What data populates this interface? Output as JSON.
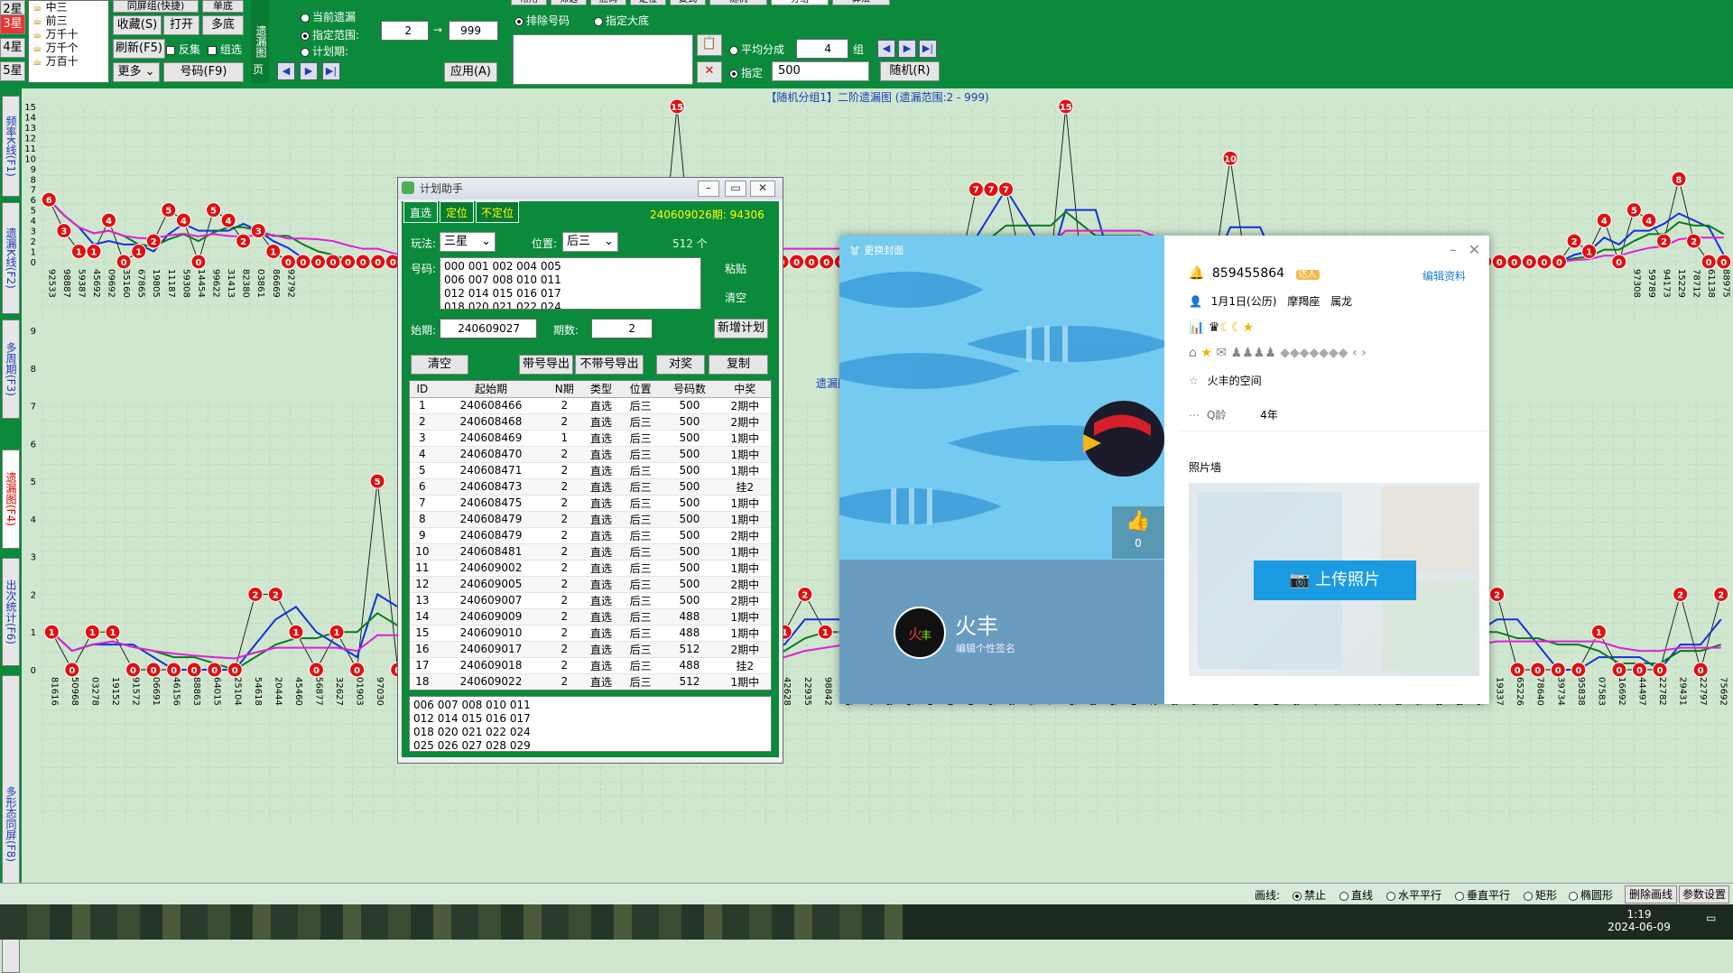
{
  "toolbar": {
    "star_tabs": [
      "2星",
      "3星",
      "4星",
      "5星"
    ],
    "pos_list": [
      "中三",
      "前三",
      "万千十",
      "万千个",
      "万百十"
    ],
    "combo_mode": "同屏组(快捷)",
    "btn_dandi": "单底",
    "btn_fav": "收藏(S)",
    "btn_open": "打开",
    "btn_duodi": "多底",
    "btn_refresh": "刷新(F5)",
    "chk_reverse": "反集",
    "chk_group": "组选",
    "btn_more": "更多",
    "btn_numbers": "号码(F9)",
    "vlabel": "遗漏图",
    "opt_current": "当前遗漏",
    "opt_range": "指定范围:",
    "opt_plan": "计划期:",
    "range_from": "2",
    "range_to": "999",
    "page_label": "页",
    "btn_apply": "应用(A)",
    "opt_exclude": "排除号码",
    "opt_bigbase": "指定大底",
    "opt_avg": "平均分成",
    "avg_groups": "4",
    "group_unit": "组",
    "opt_spec": "指定",
    "spec_value": "500",
    "btn_random": "随机(R)",
    "top_tabs": [
      "常用",
      "筛选",
      "胆码",
      "定位",
      "复式",
      "随机",
      "分组",
      "算法"
    ]
  },
  "left_tabs": [
    "频率K线(F1)",
    "遗漏K线(F2)",
    "多周期(F3)",
    "遗漏图(F4)",
    "出次统计(F6)",
    "多形态同屏(F8)"
  ],
  "chart_data": [
    {
      "type": "line",
      "title": "【随机分组1】二阶遗漏图 (遗漏范围:2 - 999)",
      "ylim": [
        0,
        15
      ],
      "categories": [
        "92533",
        "98887",
        "59387",
        "45692",
        "09692",
        "35160",
        "67865",
        "19805",
        "11187",
        "59308",
        "14454",
        "99622",
        "31413",
        "82380",
        "03861",
        "86669",
        "92792",
        "",
        "",
        "",
        "",
        "",
        "",
        "",
        "",
        "",
        "",
        "",
        "",
        "",
        "",
        "",
        "",
        "",
        "",
        "",
        "",
        "",
        "",
        "",
        "",
        "",
        "",
        "",
        "",
        "",
        "",
        "",
        "",
        "",
        "",
        "",
        "",
        "",
        "",
        "",
        "",
        "96785",
        "12555",
        "",
        "",
        "",
        "",
        "",
        "",
        "",
        "",
        "",
        "",
        "",
        "",
        "",
        "",
        "",
        "",
        "",
        "",
        "",
        "",
        "",
        "",
        "",
        "",
        "",
        "",
        "",
        "",
        "",
        "",
        "",
        "",
        "",
        "",
        "",
        "",
        "",
        "",
        "",
        "",
        "",
        "",
        "",
        "",
        "",
        "",
        "",
        "97308",
        "59789",
        "94173",
        "15229",
        "78712",
        "61138",
        "88975",
        "33399",
        "22782",
        "75692"
      ],
      "series": [
        {
          "name": "遗漏",
          "values": [
            6,
            3,
            1,
            1,
            4,
            0,
            1,
            2,
            5,
            4,
            0,
            5,
            4,
            2,
            3,
            1,
            0,
            0,
            0,
            0,
            0,
            0,
            0,
            0,
            0,
            0,
            0,
            0,
            0,
            0,
            0,
            0,
            0,
            0,
            0,
            0,
            0,
            0,
            0,
            0,
            0,
            0,
            15,
            0,
            0,
            0,
            0,
            0,
            0,
            0,
            0,
            0,
            0,
            0,
            0,
            0,
            0,
            0,
            0,
            0,
            0,
            0,
            7,
            7,
            7,
            0,
            0,
            0,
            15,
            0,
            0,
            0,
            0,
            0,
            0,
            0,
            0,
            0,
            0,
            10,
            0,
            0,
            0,
            0,
            0,
            0,
            0,
            0,
            0,
            0,
            0,
            0,
            0,
            0,
            0,
            0,
            0,
            0,
            0,
            0,
            0,
            0,
            2,
            1,
            4,
            0,
            5,
            4,
            2,
            8,
            2,
            0,
            0
          ]
        }
      ],
      "chart_type_note": ""
    },
    {
      "type": "line",
      "title": "遗漏图 (历史",
      "ylim": [
        0,
        9
      ],
      "categories": [
        "81616",
        "50968",
        "03278",
        "19152",
        "91572",
        "06691",
        "46156",
        "88863",
        "64015",
        "25104",
        "54618",
        "20444",
        "45460",
        "56877",
        "32627",
        "01903",
        "97030",
        "25837",
        "00379",
        "13975",
        "01914",
        "55657",
        "86436",
        "09297",
        "65618",
        "95653",
        "30028",
        "45679",
        "83330",
        "11862",
        "25095",
        "33418",
        "18155",
        "23868",
        "79418",
        "16677",
        "42628",
        "22935",
        "98842",
        "65376",
        "39337",
        "64623",
        "64096",
        "39709",
        "37190",
        "78800",
        "57035",
        "34703",
        "59774",
        "32421",
        "10236",
        "97308",
        "84186",
        "65789",
        "69352",
        "23143",
        "73285",
        "17403",
        "73351",
        "15229",
        "62340",
        "72433",
        "03954",
        "24164",
        "91452",
        "78712",
        "52193",
        "39854",
        "61138",
        "32788",
        "88975",
        "19337",
        "65226",
        "78640",
        "39734",
        "95838",
        "07583",
        "16692",
        "44497",
        "22782",
        "29431",
        "22797",
        "75692"
      ],
      "series": [
        {
          "name": "遗漏",
          "values": [
            1,
            0,
            1,
            1,
            0,
            0,
            0,
            0,
            0,
            0,
            2,
            2,
            1,
            0,
            1,
            0,
            5,
            0,
            0,
            1,
            0,
            1,
            0,
            0,
            0,
            0,
            0,
            0,
            1,
            0,
            0,
            0,
            0,
            1,
            0,
            1,
            1,
            2,
            1,
            1,
            0,
            0,
            0,
            0,
            2,
            0,
            0,
            0,
            0,
            0,
            0,
            0,
            0,
            2,
            1,
            0,
            0,
            0,
            0,
            1,
            0,
            0,
            0,
            0,
            1,
            2,
            1,
            0,
            1,
            0,
            2,
            2,
            0,
            0,
            0,
            0,
            1,
            0,
            0,
            0,
            2,
            0,
            2
          ]
        }
      ]
    }
  ],
  "planner": {
    "title": "计划助手",
    "tabs": [
      "直选",
      "定位",
      "不定位"
    ],
    "period_info": "240609026期:",
    "period_num": "94306",
    "play_label": "玩法:",
    "play_value": "三星",
    "pos_label": "位置:",
    "pos_value": "后三",
    "count": "512 个",
    "code_label": "号码:",
    "codes": [
      "000 001 002 004 005",
      "006 007 008 010 011",
      "012 014 015 016 017",
      "018 020 021 022 024"
    ],
    "paste": "粘贴",
    "clear": "清空",
    "start_label": "始期:",
    "start_value": "240609027",
    "periods_label": "期数:",
    "periods_value": "2",
    "btn_new": "新增计划",
    "btn_clear": "清空",
    "btn_export_num": "带号导出",
    "btn_export_nonum": "不带号导出",
    "btn_compare": "对奖",
    "btn_copy": "复制",
    "columns": [
      "ID",
      "起始期",
      "N期",
      "类型",
      "位置",
      "号码数",
      "中奖"
    ],
    "rows": [
      [
        "1",
        "240608466",
        "2",
        "直选",
        "后三",
        "500",
        "2期中"
      ],
      [
        "2",
        "240608468",
        "2",
        "直选",
        "后三",
        "500",
        "2期中"
      ],
      [
        "3",
        "240608469",
        "1",
        "直选",
        "后三",
        "500",
        "1期中"
      ],
      [
        "4",
        "240608470",
        "2",
        "直选",
        "后三",
        "500",
        "1期中"
      ],
      [
        "5",
        "240608471",
        "2",
        "直选",
        "后三",
        "500",
        "1期中"
      ],
      [
        "6",
        "240608473",
        "2",
        "直选",
        "后三",
        "500",
        "挂2"
      ],
      [
        "7",
        "240608475",
        "2",
        "直选",
        "后三",
        "500",
        "1期中"
      ],
      [
        "8",
        "240608479",
        "2",
        "直选",
        "后三",
        "500",
        "1期中"
      ],
      [
        "9",
        "240608479",
        "2",
        "直选",
        "后三",
        "500",
        "2期中"
      ],
      [
        "10",
        "240608481",
        "2",
        "直选",
        "后三",
        "500",
        "1期中"
      ],
      [
        "11",
        "240609002",
        "2",
        "直选",
        "后三",
        "500",
        "1期中"
      ],
      [
        "12",
        "240609005",
        "2",
        "直选",
        "后三",
        "500",
        "2期中"
      ],
      [
        "13",
        "240609007",
        "2",
        "直选",
        "后三",
        "500",
        "2期中"
      ],
      [
        "14",
        "240609009",
        "2",
        "直选",
        "后三",
        "488",
        "1期中"
      ],
      [
        "15",
        "240609010",
        "2",
        "直选",
        "后三",
        "488",
        "1期中"
      ],
      [
        "16",
        "240609017",
        "2",
        "直选",
        "后三",
        "512",
        "2期中"
      ],
      [
        "17",
        "240609018",
        "2",
        "直选",
        "后三",
        "488",
        "挂2"
      ],
      [
        "18",
        "240609022",
        "2",
        "直选",
        "后三",
        "512",
        "1期中"
      ]
    ],
    "bottom_codes": [
      "006 007 008 010 011",
      "012 014 015 016 017",
      "018 020 021 022 024",
      "025 026 027 028 029"
    ]
  },
  "profile": {
    "change_cover": "更换封面",
    "qq": "859455864",
    "badge": "达人",
    "edit": "编辑资料",
    "birthday": "1月1日(公历)",
    "zodiac": "摩羯座",
    "animal": "属龙",
    "space": "火丰的空间",
    "age_label": "Q龄",
    "age_value": "4年",
    "photo_wall": "照片墙",
    "upload": "上传照片",
    "nickname": "火丰",
    "signature": "编辑个性签名",
    "likes": "0"
  },
  "status": {
    "draw_label": "画线:",
    "options": [
      "禁止",
      "直线",
      "水平平行",
      "垂直平行",
      "矩形",
      "椭圆形"
    ],
    "btn_delete": "删除画线",
    "btn_params": "参数设置",
    "time": "1:19",
    "date": "2024-06-09"
  }
}
